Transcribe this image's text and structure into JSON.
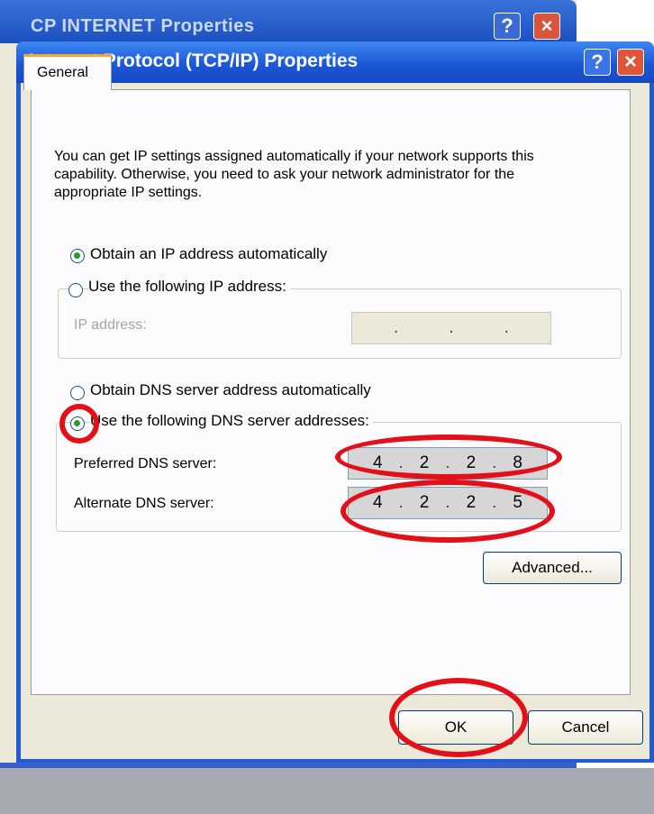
{
  "background_window": {
    "title": "CP INTERNET Properties",
    "help": "?",
    "close": "×"
  },
  "dialog": {
    "title": "Internet Protocol (TCP/IP) Properties",
    "help": "?",
    "close": "×",
    "tab": "General",
    "intro": "You can get IP settings assigned automatically if your network supports this capability. Otherwise, you need to ask your network administrator for the appropriate IP settings.",
    "ip": {
      "auto_label": "Obtain an IP address automatically",
      "manual_label": "Use the following IP address:",
      "selected": "auto",
      "ip_address_label": "IP address:",
      "ip_address_value": [
        ".",
        ".",
        "."
      ]
    },
    "dns": {
      "auto_label": "Obtain DNS server address automatically",
      "manual_label": "Use the following DNS server addresses:",
      "selected": "manual",
      "preferred_label": "Preferred DNS server:",
      "preferred_value": [
        "4",
        "2",
        "2",
        "8"
      ],
      "alternate_label": "Alternate DNS server:",
      "alternate_value": [
        "4",
        "2",
        "2",
        "5"
      ]
    },
    "advanced_button": "Advanced...",
    "ok_button": "OK",
    "cancel_button": "Cancel"
  },
  "colors": {
    "annotation": "#e3101a",
    "titlebar": "#1a55d4",
    "face": "#ece9d8"
  }
}
